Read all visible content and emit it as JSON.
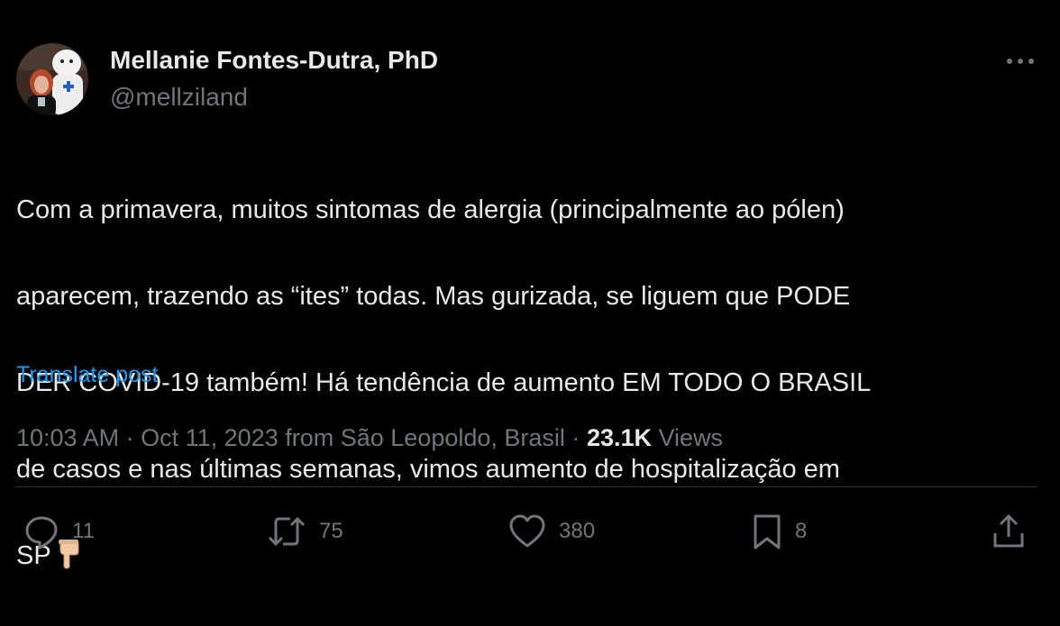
{
  "author": {
    "display_name": "Mellanie Fontes-Dutra, PhD",
    "handle": "@mellziland",
    "avatar_icon": "profile-photo"
  },
  "tweet": {
    "line1": "Com a primavera, muitos sintomas de alergia (principalmente ao pólen)",
    "line2": "aparecem, trazendo as “ites” todas. Mas gurizada, se liguem que PODE",
    "line3": "DER COVID-19 também! Há tendência de aumento EM TODO O BRASIL",
    "line4": "de casos e nas últimas semanas, vimos aumento de hospitalização em",
    "line5": "SP",
    "emoji": "pointing-down-hand-emoji"
  },
  "translate_label": "Translate post",
  "meta": {
    "time": "10:03 AM",
    "separator": "·",
    "date": "Oct 11, 2023",
    "from_label": "from São Leopoldo, Brasil",
    "views_count": "23.1K",
    "views_label": "Views"
  },
  "actions": {
    "replies": "11",
    "reposts": "75",
    "likes": "380",
    "bookmarks": "8"
  },
  "icons": {
    "more": "more-dots-icon",
    "reply": "reply-icon",
    "repost": "repost-icon",
    "like": "heart-icon",
    "bookmark": "bookmark-icon",
    "share": "share-icon"
  },
  "colors": {
    "background": "#000000",
    "text": "#e7e9ea",
    "secondary": "#71767b",
    "link": "#1d9bf0",
    "divider": "#2f3336"
  }
}
